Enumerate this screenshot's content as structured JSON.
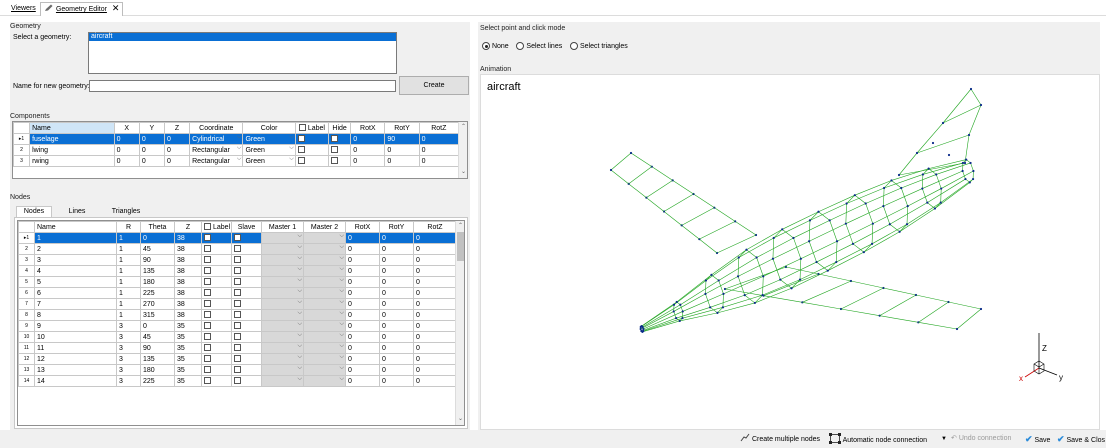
{
  "tabs": {
    "viewers": "Viewers",
    "geometry_editor": "Geometry Editor"
  },
  "geometry": {
    "group_title": "Geometry",
    "select_label": "Select a geometry:",
    "geometries": [
      "aircraft"
    ],
    "name_label": "Name for new geometry:",
    "name_value": "",
    "create_label": "Create"
  },
  "components": {
    "group_title": "Components",
    "columns": [
      "Name",
      "X",
      "Y",
      "Z",
      "Coordinate",
      "Color",
      "Label",
      "Hide",
      "RotX",
      "RotY",
      "RotZ"
    ],
    "rows": [
      {
        "idx": "1",
        "name": "fuselage",
        "x": "0",
        "y": "0",
        "z": "0",
        "coord": "Cylindrical",
        "color": "Green",
        "rotx": "0",
        "roty": "90",
        "rotz": "0"
      },
      {
        "idx": "2",
        "name": "lwing",
        "x": "0",
        "y": "0",
        "z": "0",
        "coord": "Rectangular",
        "color": "Green",
        "rotx": "0",
        "roty": "0",
        "rotz": "0"
      },
      {
        "idx": "3",
        "name": "rwing",
        "x": "0",
        "y": "0",
        "z": "0",
        "coord": "Rectangular",
        "color": "Green",
        "rotx": "0",
        "roty": "0",
        "rotz": "0"
      }
    ]
  },
  "nodes": {
    "group_title": "Nodes",
    "tabs": [
      "Nodes",
      "Lines",
      "Triangles"
    ],
    "columns": [
      "Name",
      "R",
      "Theta",
      "Z",
      "Label",
      "Slave",
      "Master 1",
      "Master 2",
      "RotX",
      "RotY",
      "RotZ"
    ],
    "rows": [
      {
        "idx": "1",
        "name": "1",
        "r": "1",
        "theta": "0",
        "z": "38",
        "rotx": "0",
        "roty": "0",
        "rotz": "0"
      },
      {
        "idx": "2",
        "name": "2",
        "r": "1",
        "theta": "45",
        "z": "38",
        "rotx": "0",
        "roty": "0",
        "rotz": "0"
      },
      {
        "idx": "3",
        "name": "3",
        "r": "1",
        "theta": "90",
        "z": "38",
        "rotx": "0",
        "roty": "0",
        "rotz": "0"
      },
      {
        "idx": "4",
        "name": "4",
        "r": "1",
        "theta": "135",
        "z": "38",
        "rotx": "0",
        "roty": "0",
        "rotz": "0"
      },
      {
        "idx": "5",
        "name": "5",
        "r": "1",
        "theta": "180",
        "z": "38",
        "rotx": "0",
        "roty": "0",
        "rotz": "0"
      },
      {
        "idx": "6",
        "name": "6",
        "r": "1",
        "theta": "225",
        "z": "38",
        "rotx": "0",
        "roty": "0",
        "rotz": "0"
      },
      {
        "idx": "7",
        "name": "7",
        "r": "1",
        "theta": "270",
        "z": "38",
        "rotx": "0",
        "roty": "0",
        "rotz": "0"
      },
      {
        "idx": "8",
        "name": "8",
        "r": "1",
        "theta": "315",
        "z": "38",
        "rotx": "0",
        "roty": "0",
        "rotz": "0"
      },
      {
        "idx": "9",
        "name": "9",
        "r": "3",
        "theta": "0",
        "z": "35",
        "rotx": "0",
        "roty": "0",
        "rotz": "0"
      },
      {
        "idx": "10",
        "name": "10",
        "r": "3",
        "theta": "45",
        "z": "35",
        "rotx": "0",
        "roty": "0",
        "rotz": "0"
      },
      {
        "idx": "11",
        "name": "11",
        "r": "3",
        "theta": "90",
        "z": "35",
        "rotx": "0",
        "roty": "0",
        "rotz": "0"
      },
      {
        "idx": "12",
        "name": "12",
        "r": "3",
        "theta": "135",
        "z": "35",
        "rotx": "0",
        "roty": "0",
        "rotz": "0"
      },
      {
        "idx": "13",
        "name": "13",
        "r": "3",
        "theta": "180",
        "z": "35",
        "rotx": "0",
        "roty": "0",
        "rotz": "0"
      },
      {
        "idx": "14",
        "name": "14",
        "r": "3",
        "theta": "225",
        "z": "35",
        "rotx": "0",
        "roty": "0",
        "rotz": "0"
      }
    ]
  },
  "select_mode": {
    "group_title": "Select point and click mode",
    "options": [
      "None",
      "Select lines",
      "Select triangles"
    ],
    "selected": "None"
  },
  "animation": {
    "group_title": "Animation",
    "title": "aircraft",
    "axis_z": "Z",
    "axis_x": "x",
    "axis_y": "y"
  },
  "toolbar": {
    "create_multiple": "Create multiple nodes",
    "auto_connect": "Automatic node connection",
    "undo": "Undo connection",
    "save": "Save",
    "save_close": "Save & Clos"
  },
  "colors": {
    "selection": "#0a6fd4",
    "wireframe": "#1fa51f",
    "node": "#0b2b8a",
    "check": "#2b8bd9"
  }
}
